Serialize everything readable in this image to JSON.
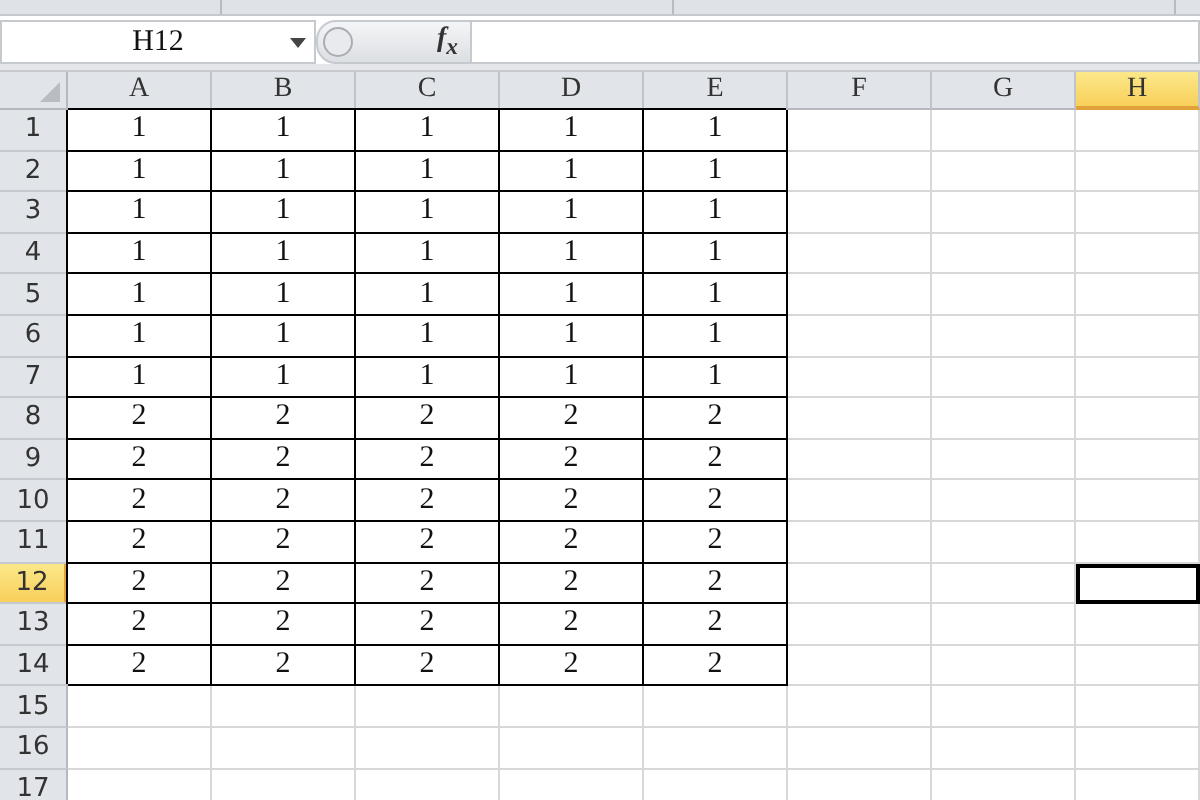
{
  "name_box": {
    "value": "H12"
  },
  "formula_bar": {
    "function_label": "f$_{x}$"
  },
  "columns": [
    {
      "label": "A",
      "selected": false
    },
    {
      "label": "B",
      "selected": false
    },
    {
      "label": "C",
      "selected": false
    },
    {
      "label": "D",
      "selected": false
    },
    {
      "label": "E",
      "selected": false
    },
    {
      "label": "F",
      "selected": false
    },
    {
      "label": "G",
      "selected": false
    },
    {
      "label": "H",
      "selected": true
    }
  ],
  "rows": [
    {
      "label": "1",
      "selected": false,
      "cells": [
        "1",
        "1",
        "1",
        "1",
        "1"
      ]
    },
    {
      "label": "2",
      "selected": false,
      "cells": [
        "1",
        "1",
        "1",
        "1",
        "1"
      ]
    },
    {
      "label": "3",
      "selected": false,
      "cells": [
        "1",
        "1",
        "1",
        "1",
        "1"
      ]
    },
    {
      "label": "4",
      "selected": false,
      "cells": [
        "1",
        "1",
        "1",
        "1",
        "1"
      ]
    },
    {
      "label": "5",
      "selected": false,
      "cells": [
        "1",
        "1",
        "1",
        "1",
        "1"
      ]
    },
    {
      "label": "6",
      "selected": false,
      "cells": [
        "1",
        "1",
        "1",
        "1",
        "1"
      ]
    },
    {
      "label": "7",
      "selected": false,
      "cells": [
        "1",
        "1",
        "1",
        "1",
        "1"
      ]
    },
    {
      "label": "8",
      "selected": false,
      "cells": [
        "2",
        "2",
        "2",
        "2",
        "2"
      ]
    },
    {
      "label": "9",
      "selected": false,
      "cells": [
        "2",
        "2",
        "2",
        "2",
        "2"
      ]
    },
    {
      "label": "10",
      "selected": false,
      "cells": [
        "2",
        "2",
        "2",
        "2",
        "2"
      ]
    },
    {
      "label": "11",
      "selected": false,
      "cells": [
        "2",
        "2",
        "2",
        "2",
        "2"
      ]
    },
    {
      "label": "12",
      "selected": true,
      "cells": [
        "2",
        "2",
        "2",
        "2",
        "2"
      ]
    },
    {
      "label": "13",
      "selected": false,
      "cells": [
        "2",
        "2",
        "2",
        "2",
        "2"
      ]
    },
    {
      "label": "14",
      "selected": false,
      "cells": [
        "2",
        "2",
        "2",
        "2",
        "2"
      ]
    },
    {
      "label": "15",
      "selected": false,
      "cells": []
    },
    {
      "label": "16",
      "selected": false,
      "cells": []
    },
    {
      "label": "17",
      "selected": false,
      "cells": []
    }
  ]
}
